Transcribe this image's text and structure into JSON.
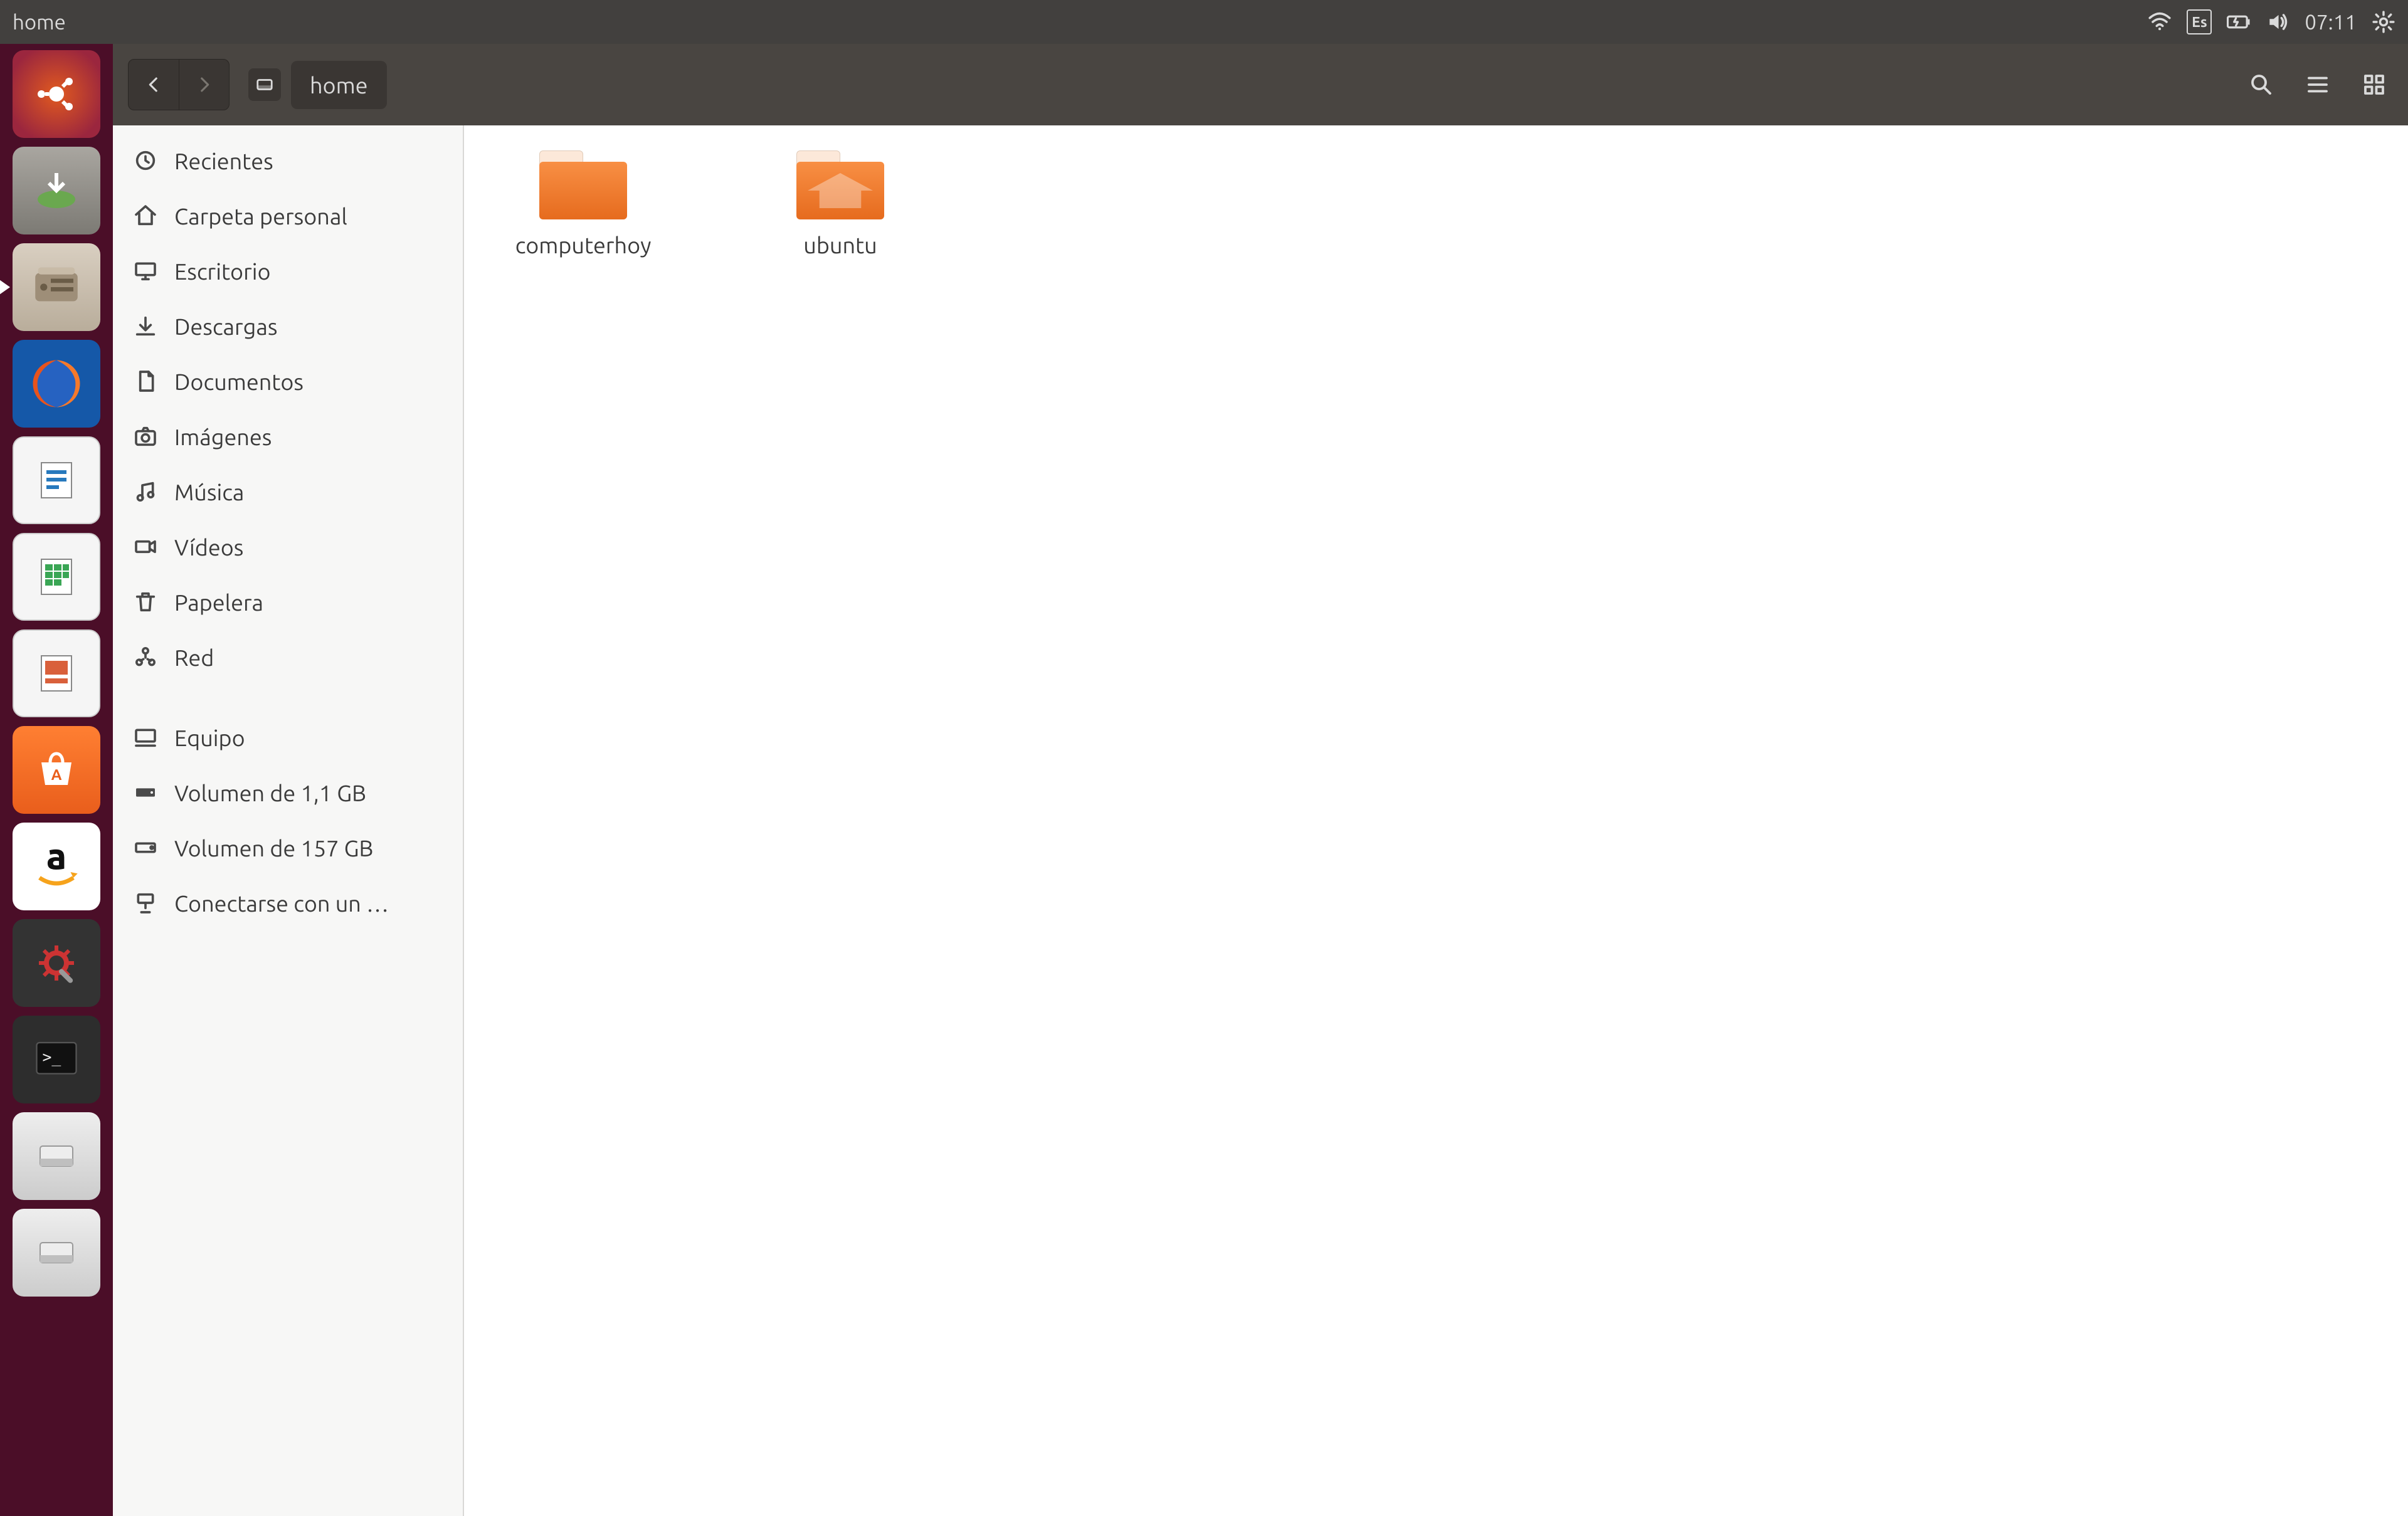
{
  "menubar": {
    "title": "home",
    "language": "Es",
    "clock": "07:11"
  },
  "toolbar": {
    "location": "home"
  },
  "sidebar": {
    "places": [
      {
        "id": "recent",
        "label": "Recientes"
      },
      {
        "id": "home",
        "label": "Carpeta personal"
      },
      {
        "id": "desktop",
        "label": "Escritorio"
      },
      {
        "id": "downloads",
        "label": "Descargas"
      },
      {
        "id": "documents",
        "label": "Documentos"
      },
      {
        "id": "pictures",
        "label": "Imágenes"
      },
      {
        "id": "music",
        "label": "Música"
      },
      {
        "id": "videos",
        "label": "Vídeos"
      },
      {
        "id": "trash",
        "label": "Papelera"
      },
      {
        "id": "network",
        "label": "Red"
      }
    ],
    "devices": [
      {
        "id": "computer",
        "label": "Equipo"
      },
      {
        "id": "vol-1",
        "label": "Volumen de 1,1 GB"
      },
      {
        "id": "vol-2",
        "label": "Volumen de 157 GB"
      },
      {
        "id": "connect",
        "label": "Conectarse con un …"
      }
    ]
  },
  "files": [
    {
      "name": "computerhoy",
      "type": "folder"
    },
    {
      "name": "ubuntu",
      "type": "folder-home"
    }
  ],
  "launcher": [
    {
      "id": "dash",
      "name": "Dash"
    },
    {
      "id": "disk",
      "name": "Startup Disk Creator"
    },
    {
      "id": "files",
      "name": "Files",
      "active": true
    },
    {
      "id": "firefox",
      "name": "Firefox"
    },
    {
      "id": "lo-writer",
      "name": "LibreOffice Writer"
    },
    {
      "id": "lo-calc",
      "name": "LibreOffice Calc"
    },
    {
      "id": "lo-impress",
      "name": "LibreOffice Impress"
    },
    {
      "id": "software",
      "name": "Ubuntu Software"
    },
    {
      "id": "amazon",
      "name": "Amazon"
    },
    {
      "id": "settings",
      "name": "System Settings"
    },
    {
      "id": "terminal",
      "name": "Terminal"
    },
    {
      "id": "volume-a",
      "name": "Removable Drive"
    },
    {
      "id": "volume-b",
      "name": "Removable Drive"
    }
  ]
}
